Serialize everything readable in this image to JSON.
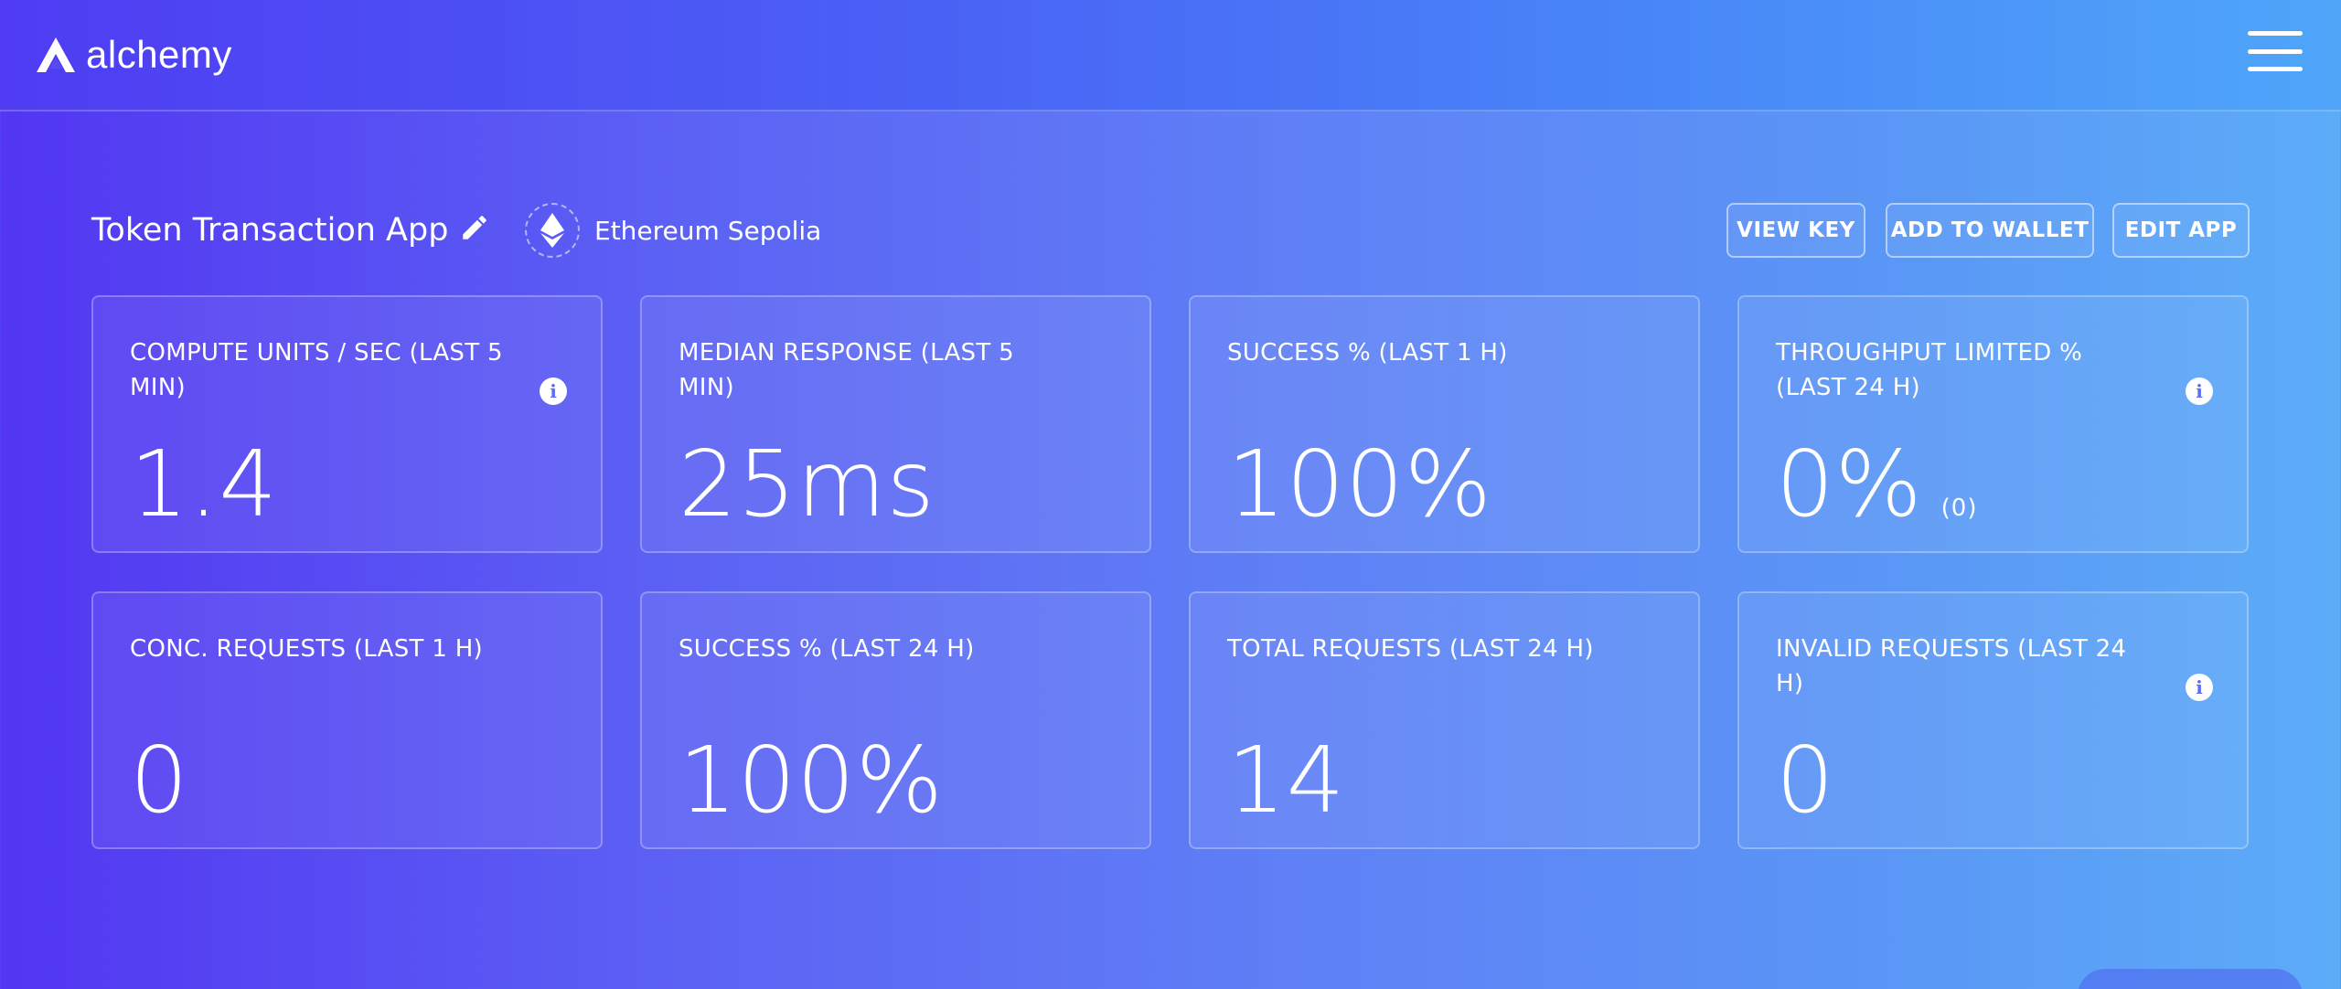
{
  "header": {
    "logo_text": "alchemy",
    "menu_icon": "hamburger-menu-icon"
  },
  "app": {
    "title": "Token Transaction App",
    "edit_icon": "pencil-icon",
    "network_icon": "ethereum-icon",
    "network": "Ethereum Sepolia"
  },
  "actions": {
    "view_key": "VIEW KEY",
    "add_to_wallet": "ADD TO WALLET",
    "edit_app": "EDIT APP"
  },
  "stats": [
    {
      "label": "COMPUTE UNITS / SEC (LAST 5 MIN)",
      "value": "1.4",
      "info": true
    },
    {
      "label": "MEDIAN RESPONSE (LAST 5 MIN)",
      "value": "25ms",
      "info": false
    },
    {
      "label": "SUCCESS % (LAST 1 H)",
      "value": "100%",
      "info": false
    },
    {
      "label": "THROUGHPUT LIMITED % (LAST 24 H)",
      "value": "0%",
      "sub": "(0)",
      "info": true
    },
    {
      "label": "CONC. REQUESTS (LAST 1 H)",
      "value": "0",
      "info": false
    },
    {
      "label": "SUCCESS % (LAST 24 H)",
      "value": "100%",
      "info": false
    },
    {
      "label": "TOTAL REQUESTS (LAST 24 H)",
      "value": "14",
      "info": false
    },
    {
      "label": "INVALID REQUESTS (LAST 24 H)",
      "value": "0",
      "info": true
    }
  ],
  "colors": {
    "gradient_start": "#5236f2",
    "gradient_end": "#5cacf8",
    "text": "#ffffff"
  }
}
